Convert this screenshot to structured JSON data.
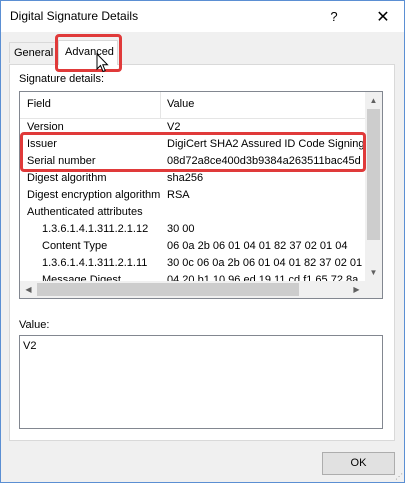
{
  "window": {
    "title": "Digital Signature Details"
  },
  "titlebar": {
    "help_label": "?",
    "close_label": "✕"
  },
  "tabs": [
    {
      "label": "General",
      "selected": false
    },
    {
      "label": "Advanced",
      "selected": true
    }
  ],
  "signature_details": {
    "label": "Signature details:",
    "columns": [
      "Field",
      "Value"
    ],
    "rows": [
      {
        "field": "Version",
        "value": "V2",
        "indent": 0
      },
      {
        "field": "Issuer",
        "value": "DigiCert SHA2 Assured ID Code Signing ...",
        "indent": 0,
        "highlighted": true
      },
      {
        "field": "Serial number",
        "value": "08d72a8ce400d3b9384a263511bac45d",
        "indent": 0,
        "highlighted": true
      },
      {
        "field": "Digest algorithm",
        "value": "sha256",
        "indent": 0
      },
      {
        "field": "Digest encryption algorithm",
        "value": "RSA",
        "indent": 0
      },
      {
        "field": "Authenticated attributes",
        "value": "",
        "indent": 0
      },
      {
        "field": "1.3.6.1.4.1.311.2.1.12",
        "value": "30 00",
        "indent": 1
      },
      {
        "field": "Content Type",
        "value": "06 0a 2b 06 01 04 01 82 37 02 01 04",
        "indent": 1
      },
      {
        "field": "1.3.6.1.4.1.311.2.1.11",
        "value": "30 0c 06 0a 2b 06 01 04 01 82 37 02 01 ...",
        "indent": 1
      },
      {
        "field": "Message Digest",
        "value": "04 20 b1 10 96 ed 19 11 cd f1 65 72 8a ...",
        "indent": 1
      }
    ]
  },
  "value_section": {
    "label": "Value:",
    "content": "V2"
  },
  "buttons": {
    "ok_label": "OK"
  },
  "colors": {
    "highlight": "#e03a3a",
    "window_border": "#5b8fd3"
  }
}
